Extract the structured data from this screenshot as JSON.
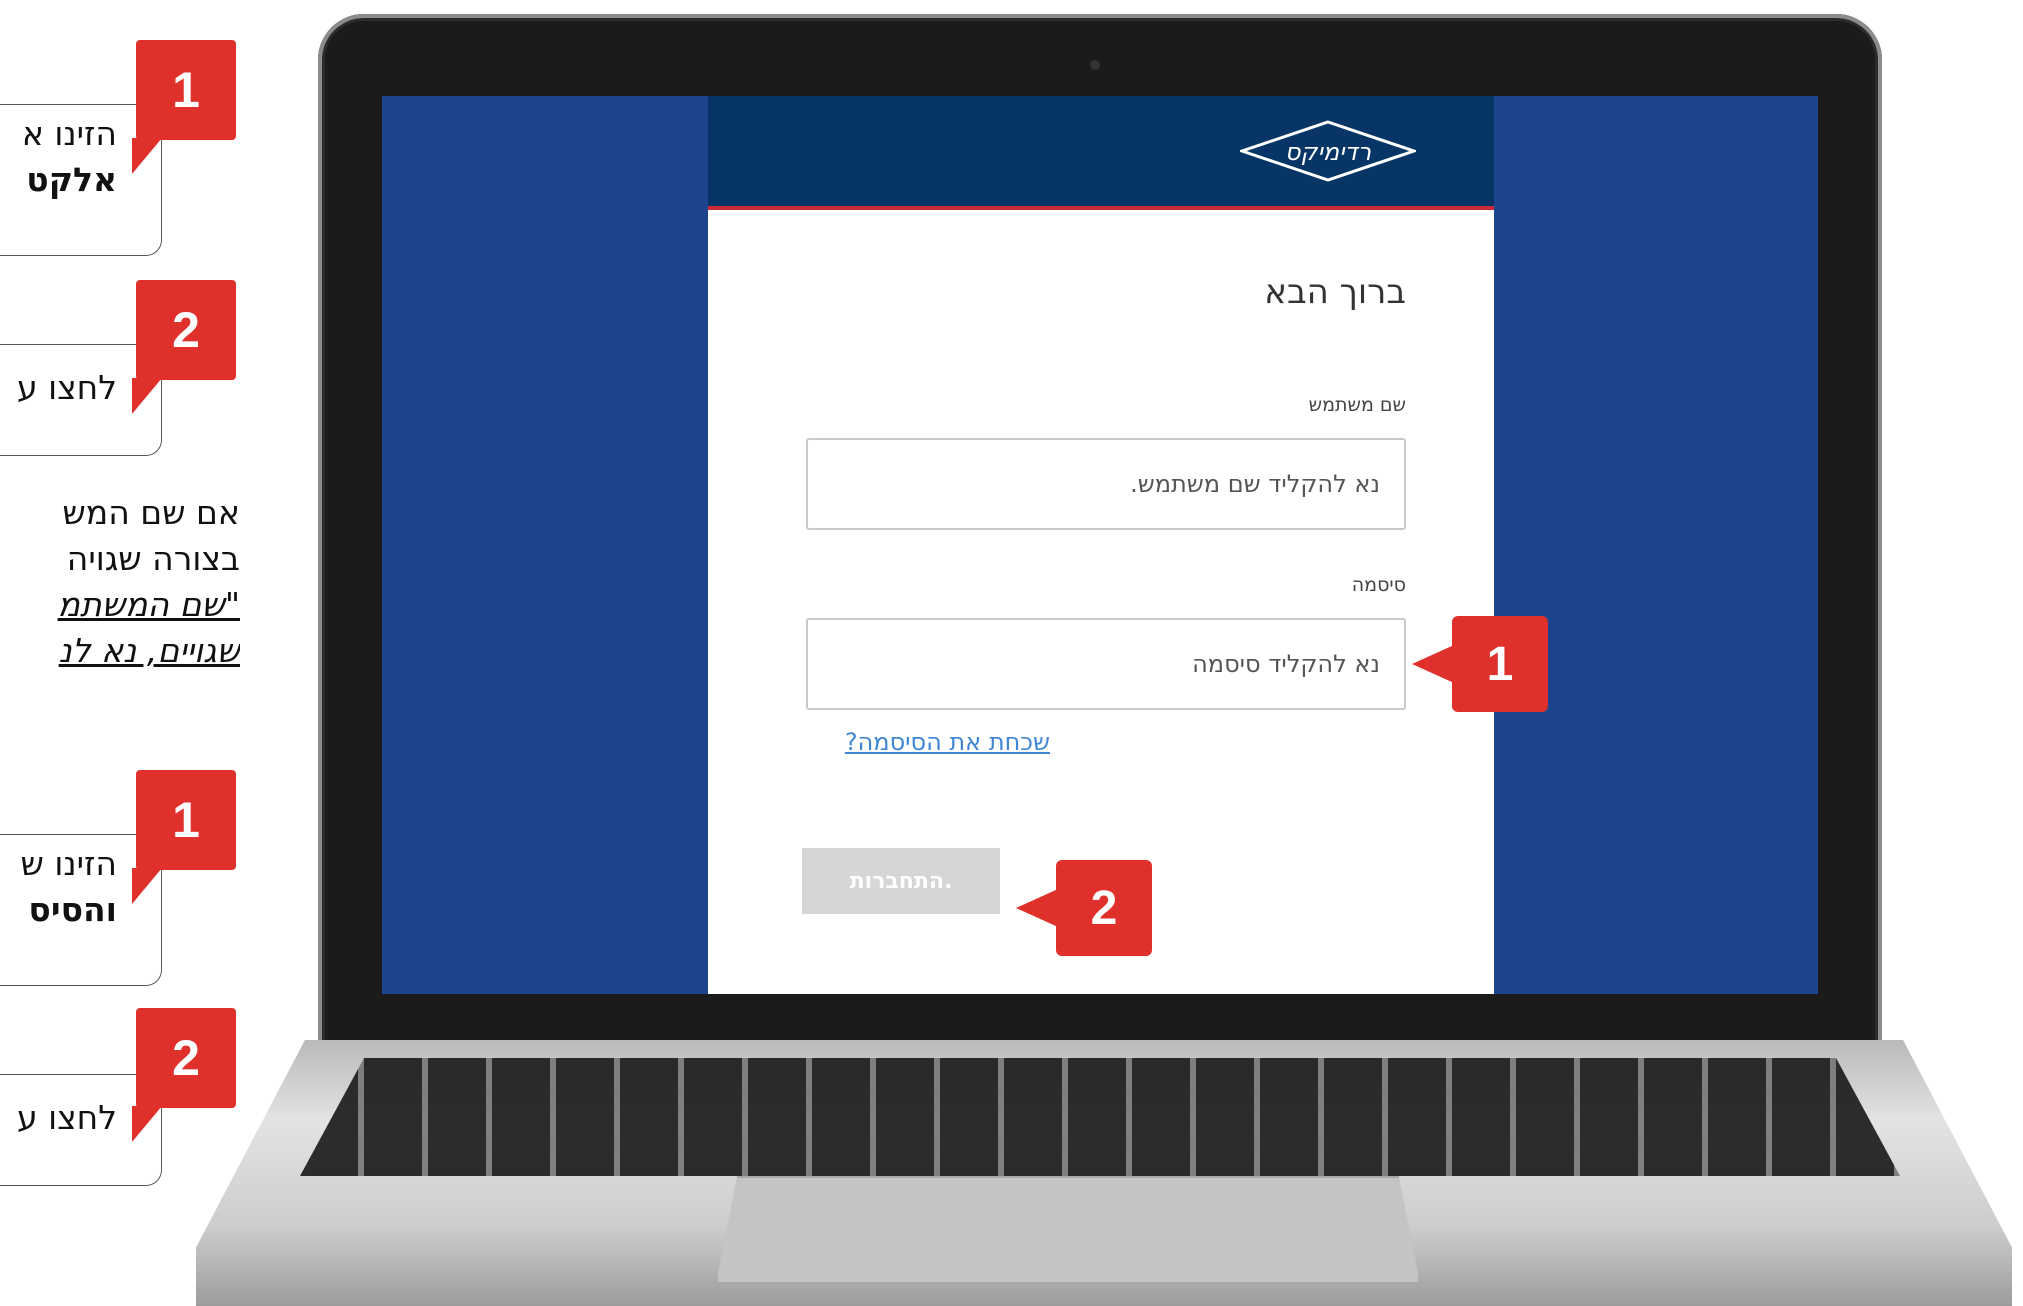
{
  "instructions": {
    "step1_top": {
      "number": "1",
      "line1": "הזינו א",
      "line2": "אלקט"
    },
    "step2_top": {
      "number": "2",
      "line1": "לחצו ע"
    },
    "error_note": {
      "line1": "אם שם המש",
      "line2": "בצורה שגויה",
      "quote1": "\"שם המשתמ",
      "quote2": "שגויים, נא לנ"
    },
    "step1_bottom": {
      "number": "1",
      "line1": "הזינו ש",
      "line2": "והסיס"
    },
    "step2_bottom": {
      "number": "2",
      "line1": "לחצו ע"
    }
  },
  "login": {
    "logo_text": "רדימיקס",
    "welcome": "ברוך הבא",
    "username_label": "שם משתמש",
    "username_placeholder": "נא להקליד שם משתמש.",
    "password_label": "סיסמה",
    "password_placeholder": "נא להקליד סיסמה",
    "forgot_link": "שכחת את הסיסמה?",
    "login_button": "התחברות."
  },
  "screen_badges": {
    "password": "1",
    "login": "2"
  },
  "colors": {
    "screen_bg": "#1c458d",
    "header_bg": "#063566",
    "header_accent": "#cc2a36",
    "badge_red": "#e0302b",
    "link_blue": "#3f86d4"
  }
}
